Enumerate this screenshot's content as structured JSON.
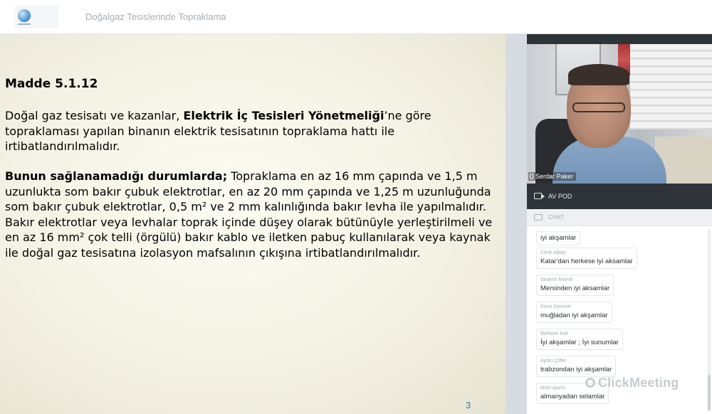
{
  "header": {
    "title": "Doğalgaz Tesislerinde Topraklama"
  },
  "slide": {
    "heading": "Madde 5.1.12",
    "p1": {
      "t1": "Doğal gaz tesisatı ve kazanlar, ",
      "b1": "Elektrik İç Tesisleri Yönetmeliği",
      "t2": "’ne göre topraklaması yapılan binanın elektrik tesisatının topraklama hattı ile irtibatlandırılmalıdır."
    },
    "p2": {
      "b1": "Bunun sağlanamadığı durumlarda;",
      "t1": " Topraklama en az 16 mm çapında ve 1,5 m uzunlukta som bakır çubuk elektrotlar, en az 20 mm çapında ve 1,25 m uzunluğunda som bakır çubuk elektrotlar, 0,5 m² ve 2 mm kalınlığında bakır levha ile yapılmalıdır. Bakır elektrotlar veya levhalar toprak içinde düşey olarak bütünüyle yerleştirilmeli ve en az 16 mm² çok telli (örgülü) bakır kablo ve iletken pabuç kullanılarak veya kaynak ile doğal gaz tesisatına izolasyon mafsalının çıkışına irtibatlandırılmalıdır."
    },
    "page_number": "3"
  },
  "video": {
    "presenter_name": "Serdar Paker"
  },
  "av_pod": {
    "label": "AV POD"
  },
  "chat": {
    "label": "CHAT",
    "messages": [
      {
        "author": "",
        "text": "iyi akşamlar"
      },
      {
        "author": "Cenk Alpay",
        "text": "Katar'dan herkese iyi aksamlar"
      },
      {
        "author": "İbrahim Memili",
        "text": "Mersinden iyi aksamlar"
      },
      {
        "author": "Emre Demirel",
        "text": "muğladan iyi akşamlar"
      },
      {
        "author": "Mehmet İnel",
        "text": "İyi akşamlar ; İyi sunumlar"
      },
      {
        "author": "Aydın Çifter",
        "text": "trabzondan iyi akşamlar"
      },
      {
        "author": "birol ugurlu",
        "text": "almanyadan selamlar"
      }
    ]
  },
  "watermark": {
    "text": "ClickMeeting"
  },
  "colors": {
    "dark_bar": "#2e3438",
    "page_number": "#3d7ab8"
  },
  "icons": [
    "logo-globe",
    "camera-icon",
    "chat-icon",
    "mic-icon"
  ]
}
